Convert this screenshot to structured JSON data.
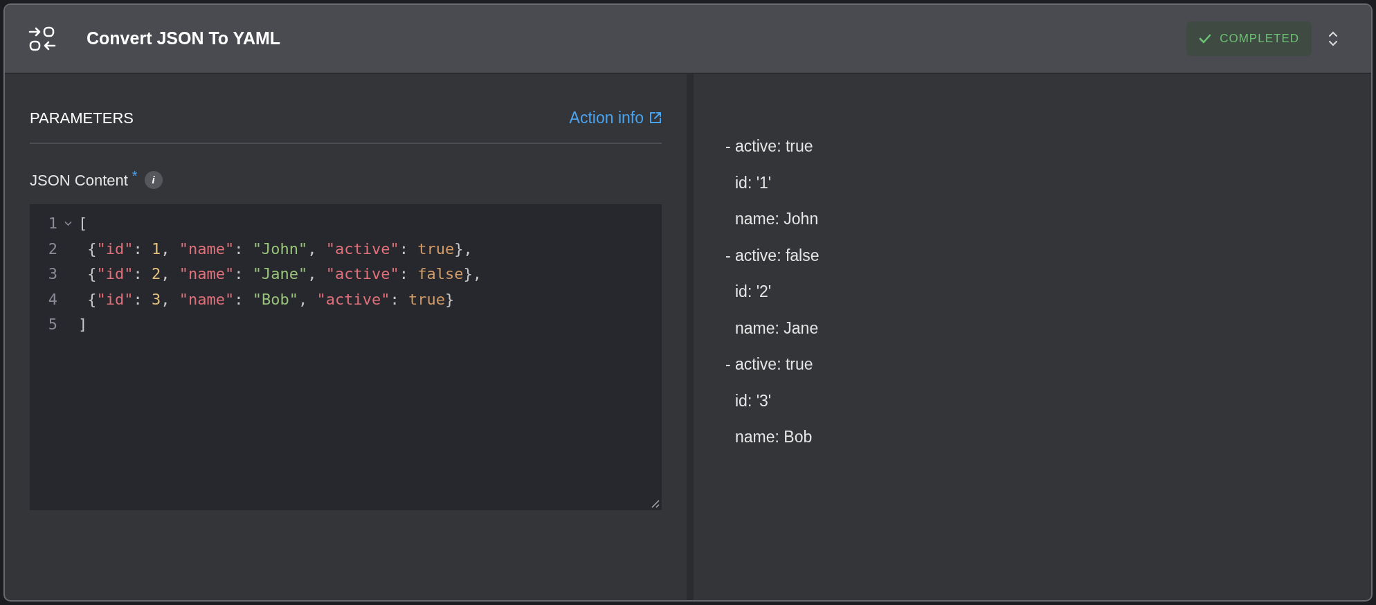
{
  "header": {
    "title": "Convert JSON To YAML",
    "status": {
      "label": "COMPLETED",
      "kind": "success"
    }
  },
  "parameters": {
    "title": "PARAMETERS",
    "link": "Action info",
    "field": {
      "label": "JSON Content",
      "required_mark": "*",
      "info": "i",
      "lines": [
        {
          "number": "1",
          "fold": true,
          "tokens": [
            {
              "kind": "punct",
              "text": "["
            }
          ]
        },
        {
          "number": "2",
          "fold": false,
          "tokens": [
            {
              "kind": "punct",
              "text": " {"
            },
            {
              "kind": "key",
              "text": "\"id\""
            },
            {
              "kind": "punct",
              "text": ": "
            },
            {
              "kind": "num",
              "text": "1"
            },
            {
              "kind": "punct",
              "text": ", "
            },
            {
              "kind": "key",
              "text": "\"name\""
            },
            {
              "kind": "punct",
              "text": ": "
            },
            {
              "kind": "str",
              "text": "\"John\""
            },
            {
              "kind": "punct",
              "text": ", "
            },
            {
              "kind": "key",
              "text": "\"active\""
            },
            {
              "kind": "punct",
              "text": ": "
            },
            {
              "kind": "bool",
              "text": "true"
            },
            {
              "kind": "punct",
              "text": "},"
            }
          ]
        },
        {
          "number": "3",
          "fold": false,
          "tokens": [
            {
              "kind": "punct",
              "text": " {"
            },
            {
              "kind": "key",
              "text": "\"id\""
            },
            {
              "kind": "punct",
              "text": ": "
            },
            {
              "kind": "num",
              "text": "2"
            },
            {
              "kind": "punct",
              "text": ", "
            },
            {
              "kind": "key",
              "text": "\"name\""
            },
            {
              "kind": "punct",
              "text": ": "
            },
            {
              "kind": "str",
              "text": "\"Jane\""
            },
            {
              "kind": "punct",
              "text": ", "
            },
            {
              "kind": "key",
              "text": "\"active\""
            },
            {
              "kind": "punct",
              "text": ": "
            },
            {
              "kind": "bool",
              "text": "false"
            },
            {
              "kind": "punct",
              "text": "},"
            }
          ]
        },
        {
          "number": "4",
          "fold": false,
          "tokens": [
            {
              "kind": "punct",
              "text": " {"
            },
            {
              "kind": "key",
              "text": "\"id\""
            },
            {
              "kind": "punct",
              "text": ": "
            },
            {
              "kind": "num",
              "text": "3"
            },
            {
              "kind": "punct",
              "text": ", "
            },
            {
              "kind": "key",
              "text": "\"name\""
            },
            {
              "kind": "punct",
              "text": ": "
            },
            {
              "kind": "str",
              "text": "\"Bob\""
            },
            {
              "kind": "punct",
              "text": ", "
            },
            {
              "kind": "key",
              "text": "\"active\""
            },
            {
              "kind": "punct",
              "text": ": "
            },
            {
              "kind": "bool",
              "text": "true"
            },
            {
              "kind": "punct",
              "text": "}"
            }
          ]
        },
        {
          "number": "5",
          "fold": false,
          "tokens": [
            {
              "kind": "punct",
              "text": "]"
            }
          ]
        }
      ]
    }
  },
  "output": {
    "lines": [
      {
        "kind": "item",
        "text": "- active: true"
      },
      {
        "kind": "field",
        "text": "id: '1'"
      },
      {
        "kind": "field",
        "text": "name: John"
      },
      {
        "kind": "item",
        "text": "- active: false"
      },
      {
        "kind": "field",
        "text": "id: '2'"
      },
      {
        "kind": "field",
        "text": "name: Jane"
      },
      {
        "kind": "item",
        "text": "- active: true"
      },
      {
        "kind": "field",
        "text": "id: '3'"
      },
      {
        "kind": "field",
        "text": "name: Bob"
      }
    ]
  }
}
